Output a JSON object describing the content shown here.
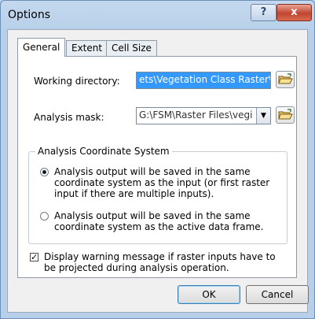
{
  "window": {
    "title": "Options",
    "help_label": "?",
    "close_label": "x"
  },
  "tabs": [
    {
      "label": "General",
      "active": true
    },
    {
      "label": "Extent",
      "active": false
    },
    {
      "label": "Cell Size",
      "active": false
    }
  ],
  "general": {
    "working_directory_label": "Working directory:",
    "working_directory_value": "ets\\Vegetation Class Raster\\",
    "analysis_mask_label": "Analysis mask:",
    "analysis_mask_value": "G:\\FSM\\Raster Files\\vegi",
    "coordinate_group_label": "Analysis Coordinate System",
    "option_input_label": "Analysis output will be saved in the same coordinate system as the input (or first raster input if there are multiple inputs).",
    "option_input_selected": true,
    "option_frame_label": "Analysis output will be saved in the same coordinate system as the active data frame.",
    "option_frame_selected": false,
    "warning_checkbox_label": "Display warning message if raster inputs have to be projected during analysis operation.",
    "warning_checkbox_checked": true
  },
  "buttons": {
    "ok_label": "OK",
    "cancel_label": "Cancel"
  },
  "icons": {
    "folder": "open-folder-icon",
    "dropdown": "chevron-down-icon"
  },
  "colors": {
    "selection": "#3399ff",
    "title_bar": "#c4d9ef",
    "close_button": "#c0462f"
  }
}
